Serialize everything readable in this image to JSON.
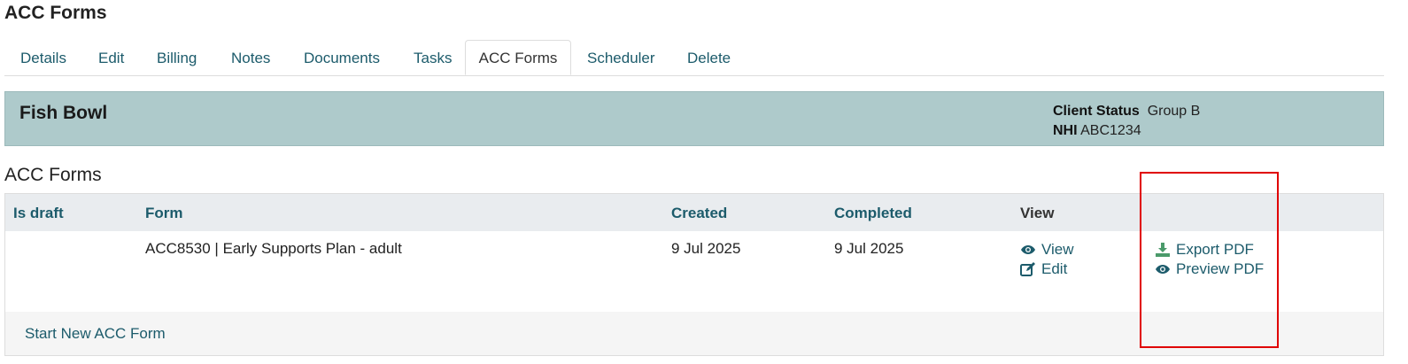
{
  "page": {
    "title": "ACC Forms"
  },
  "tabs": [
    {
      "label": "Details"
    },
    {
      "label": "Edit"
    },
    {
      "label": "Billing"
    },
    {
      "label": "Notes"
    },
    {
      "label": "Documents"
    },
    {
      "label": "Tasks"
    },
    {
      "label": "ACC Forms",
      "active": true
    },
    {
      "label": "Scheduler"
    },
    {
      "label": "Delete"
    }
  ],
  "client": {
    "name": "Fish Bowl",
    "status_label": "Client Status",
    "status_value": "Group B",
    "nhi_label": "NHI",
    "nhi_value": "ABC1234"
  },
  "section": {
    "title": "ACC Forms"
  },
  "table": {
    "headers": {
      "is_draft": "Is draft",
      "form": "Form",
      "created": "Created",
      "completed": "Completed",
      "view": "View"
    },
    "rows": [
      {
        "is_draft": "",
        "form": "ACC8530 | Early Supports Plan - adult",
        "created": "9 Jul 2025",
        "completed": "9 Jul 2025",
        "view_label": "View",
        "edit_label": "Edit",
        "export_pdf_label": "Export PDF",
        "preview_pdf_label": "Preview PDF"
      }
    ],
    "footer_link": "Start New ACC Form"
  },
  "colors": {
    "accent": "#1c5b6b",
    "banner": "#aecacb",
    "highlight": "#e00000",
    "export_icon": "#4a9a6a"
  },
  "icons": {
    "view": "eye-icon",
    "edit": "edit-icon",
    "export": "download-icon",
    "preview": "eye-icon"
  }
}
